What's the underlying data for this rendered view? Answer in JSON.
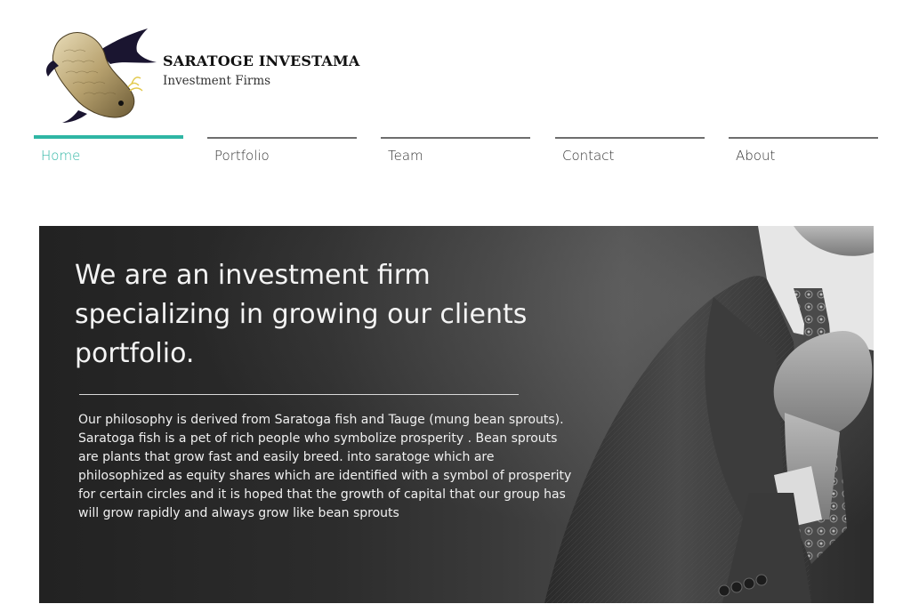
{
  "brand": {
    "name": "SARATOGE INVESTAMA",
    "tagline": "Investment Firms"
  },
  "nav": {
    "items": [
      {
        "label": "Home",
        "active": true
      },
      {
        "label": "Portfolio",
        "active": false
      },
      {
        "label": "Team",
        "active": false
      },
      {
        "label": "Contact",
        "active": false
      },
      {
        "label": "About",
        "active": false
      }
    ]
  },
  "hero": {
    "title": "We are an investment firm specializing in growing our clients portfolio.",
    "body": "Our philosophy is derived from Saratoga fish and Tauge (mung bean sprouts). Saratoga fish is a pet of rich people who symbolize prosperity . Bean sprouts are plants that grow fast and easily breed. into saratoge which are philosophized as equity shares which are identified with a symbol of prosperity for certain circles and it is hoped that the growth of capital that our group has will grow rapidly and always grow like bean sprouts"
  },
  "colors": {
    "accent": "#2fb6a4",
    "nav_line": "#6e6e6e",
    "hero_bg": "#2c2c2c"
  }
}
